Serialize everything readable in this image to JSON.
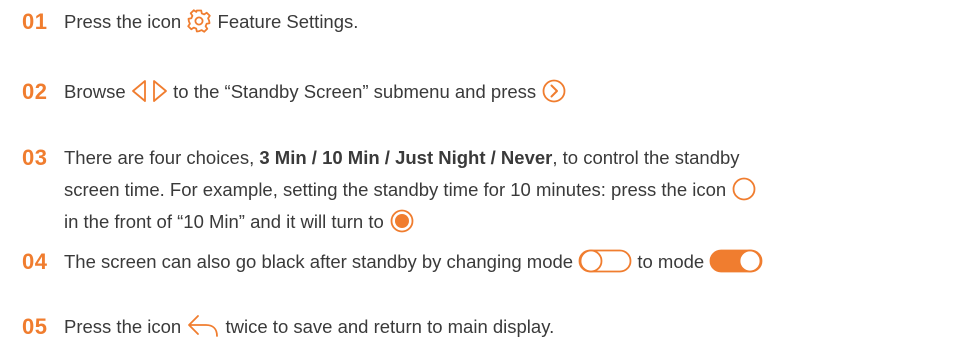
{
  "accent_color": "#f07d2f",
  "steps": [
    {
      "number": "01",
      "parts": [
        "Press the icon",
        "Feature Settings."
      ],
      "icons": [
        "gear-icon"
      ]
    },
    {
      "number": "02",
      "parts": [
        "Browse",
        "to the “Standby Screen” submenu and press"
      ],
      "icons": [
        "arrow-left-icon",
        "arrow-right-icon",
        "circle-arrow-right-icon"
      ]
    },
    {
      "number": "03",
      "line1_pre": "There are four choices,",
      "options": "3 Min / 10 Min / Just Night / Never",
      "line1_post": ", to control the standby",
      "line2": "screen time. For example, setting the standby time for 10 minutes: press the icon",
      "line3": "in the front of “10 Min” and it will turn to",
      "icons": [
        "radio-unselected-icon",
        "radio-selected-icon"
      ]
    },
    {
      "number": "04",
      "parts": [
        "The screen can also go black after standby by changing mode",
        "to mode"
      ],
      "icons": [
        "toggle-off-icon",
        "toggle-on-icon"
      ]
    },
    {
      "number": "05",
      "parts": [
        "Press the icon",
        "twice to save and return to main display."
      ],
      "icons": [
        "back-return-icon"
      ]
    }
  ]
}
